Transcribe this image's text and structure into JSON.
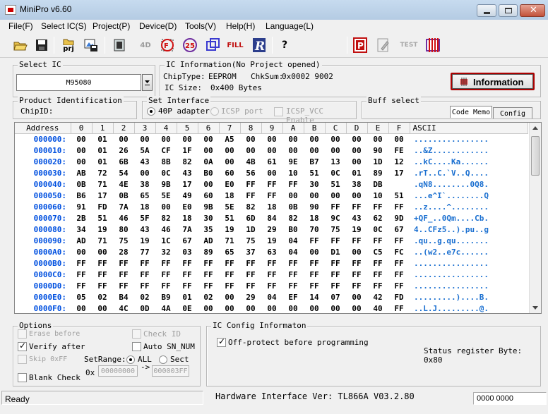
{
  "window": {
    "title": "MiniPro v6.60"
  },
  "menu": [
    "File(F)",
    "Select IC(S)",
    "Project(P)",
    "Device(D)",
    "Tools(V)",
    "Help(H)",
    "Language(L)"
  ],
  "toolbar": {
    "prj_label": "prj",
    "verify_label": "4D",
    "fill_label": "FILL",
    "test_label": "TEST",
    "info_label": "?"
  },
  "select_ic": {
    "title": "Select IC",
    "value": "M95080"
  },
  "ic_information": {
    "title": "IC Information(No Project opened)",
    "chip_type_label": "ChipType:",
    "chip_type": "EEPROM",
    "chksum_label": "ChkSum:",
    "chksum": "0x0002 9002",
    "ic_size_label": "IC Size:",
    "ic_size": "0x400 Bytes",
    "info_button": "Information"
  },
  "product_id": {
    "title": "Product Identification",
    "chip_id_label": "ChipID:"
  },
  "interface": {
    "title": "Set Interface",
    "adapter": "40P adapter",
    "icsp_port": "ICSP port",
    "icsp_vcc": "ICSP_VCC Enable"
  },
  "buff_select": {
    "title": "Buff select",
    "tab_code": "Code Memo",
    "tab_config": "Config"
  },
  "hex": {
    "columns": [
      "Address",
      "0",
      "1",
      "2",
      "3",
      "4",
      "5",
      "6",
      "7",
      "8",
      "9",
      "A",
      "B",
      "C",
      "D",
      "E",
      "F",
      "ASCII"
    ],
    "rows": [
      {
        "addr": "000000:",
        "bytes": [
          "00",
          "01",
          "00",
          "00",
          "00",
          "00",
          "00",
          "A5",
          "00",
          "00",
          "00",
          "00",
          "00",
          "00",
          "00",
          "00"
        ],
        "ascii": "................"
      },
      {
        "addr": "000010:",
        "bytes": [
          "00",
          "01",
          "26",
          "5A",
          "CF",
          "1F",
          "00",
          "00",
          "00",
          "00",
          "00",
          "00",
          "00",
          "00",
          "90",
          "FE"
        ],
        "ascii": "..&Z............"
      },
      {
        "addr": "000020:",
        "bytes": [
          "00",
          "01",
          "6B",
          "43",
          "8B",
          "82",
          "0A",
          "00",
          "4B",
          "61",
          "9E",
          "B7",
          "13",
          "00",
          "1D",
          "12"
        ],
        "ascii": "..kC....Ka......"
      },
      {
        "addr": "000030:",
        "bytes": [
          "AB",
          "72",
          "54",
          "00",
          "0C",
          "43",
          "B0",
          "60",
          "56",
          "00",
          "10",
          "51",
          "0C",
          "01",
          "89",
          "17"
        ],
        "ascii": ".rT..C.`V..Q...."
      },
      {
        "addr": "000040:",
        "bytes": [
          "0B",
          "71",
          "4E",
          "38",
          "9B",
          "17",
          "00",
          "E0",
          "FF",
          "FF",
          "FF",
          "30",
          "51",
          "38",
          "DB"
        ],
        "ascii": ".qN8........0Q8."
      },
      {
        "addr": "000050:",
        "bytes": [
          "B6",
          "17",
          "0B",
          "65",
          "5E",
          "49",
          "60",
          "18",
          "FF",
          "FF",
          "00",
          "00",
          "00",
          "00",
          "10",
          "51"
        ],
        "ascii": "...e^I`........Q"
      },
      {
        "addr": "000060:",
        "bytes": [
          "91",
          "FD",
          "7A",
          "18",
          "00",
          "E0",
          "9B",
          "5E",
          "82",
          "18",
          "0B",
          "90",
          "FF",
          "FF",
          "FF",
          "FF"
        ],
        "ascii": "..z....^........"
      },
      {
        "addr": "000070:",
        "bytes": [
          "2B",
          "51",
          "46",
          "5F",
          "82",
          "18",
          "30",
          "51",
          "6D",
          "84",
          "82",
          "18",
          "9C",
          "43",
          "62",
          "9D"
        ],
        "ascii": "+QF_..0Qm....Cb."
      },
      {
        "addr": "000080:",
        "bytes": [
          "34",
          "19",
          "80",
          "43",
          "46",
          "7A",
          "35",
          "19",
          "1D",
          "29",
          "B0",
          "70",
          "75",
          "19",
          "0C",
          "67"
        ],
        "ascii": "4..CFz5..).pu..g"
      },
      {
        "addr": "000090:",
        "bytes": [
          "AD",
          "71",
          "75",
          "19",
          "1C",
          "67",
          "AD",
          "71",
          "75",
          "19",
          "04",
          "FF",
          "FF",
          "FF",
          "FF",
          "FF"
        ],
        "ascii": ".qu..g.qu......."
      },
      {
        "addr": "0000A0:",
        "bytes": [
          "00",
          "00",
          "28",
          "77",
          "32",
          "03",
          "89",
          "65",
          "37",
          "63",
          "04",
          "00",
          "D1",
          "00",
          "C5",
          "FC"
        ],
        "ascii": "..(w2..e7c......"
      },
      {
        "addr": "0000B0:",
        "bytes": [
          "FF",
          "FF",
          "FF",
          "FF",
          "FF",
          "FF",
          "FF",
          "FF",
          "FF",
          "FF",
          "FF",
          "FF",
          "FF",
          "FF",
          "FF",
          "FF"
        ],
        "ascii": "................"
      },
      {
        "addr": "0000C0:",
        "bytes": [
          "FF",
          "FF",
          "FF",
          "FF",
          "FF",
          "FF",
          "FF",
          "FF",
          "FF",
          "FF",
          "FF",
          "FF",
          "FF",
          "FF",
          "FF",
          "FF"
        ],
        "ascii": "................"
      },
      {
        "addr": "0000D0:",
        "bytes": [
          "FF",
          "FF",
          "FF",
          "FF",
          "FF",
          "FF",
          "FF",
          "FF",
          "FF",
          "FF",
          "FF",
          "FF",
          "FF",
          "FF",
          "FF",
          "FF"
        ],
        "ascii": "................"
      },
      {
        "addr": "0000E0:",
        "bytes": [
          "05",
          "02",
          "B4",
          "02",
          "B9",
          "01",
          "02",
          "00",
          "29",
          "04",
          "EF",
          "14",
          "07",
          "00",
          "42",
          "FD"
        ],
        "ascii": ".........)....B."
      },
      {
        "addr": "0000F0:",
        "bytes": [
          "00",
          "00",
          "4C",
          "0D",
          "4A",
          "0E",
          "00",
          "00",
          "00",
          "00",
          "00",
          "00",
          "00",
          "00",
          "40",
          "FF"
        ],
        "ascii": "..L.J.........@."
      }
    ]
  },
  "options": {
    "title": "Options",
    "erase_before": "Erase before",
    "verify_after": "Verify after",
    "skip_ff": "Skip 0xFF",
    "blank_check": "Blank Check",
    "check_id": "Check ID",
    "auto_sn": "Auto SN_NUM",
    "set_range_label": "SetRange:",
    "all_label": "ALL",
    "sect_label": "Sect",
    "range_prefix": "0x",
    "range_start": "00000000",
    "range_arrow": "->",
    "range_end": "000003FF"
  },
  "ic_config": {
    "title": "IC Config Informaton",
    "off_protect": "Off-protect before programming",
    "status_register": "Status register Byte: 0x80"
  },
  "statusbar": {
    "state": "Ready",
    "hardware": "Hardware Interface Ver: TL866A V03.2.80",
    "counter": "0000 0000"
  }
}
